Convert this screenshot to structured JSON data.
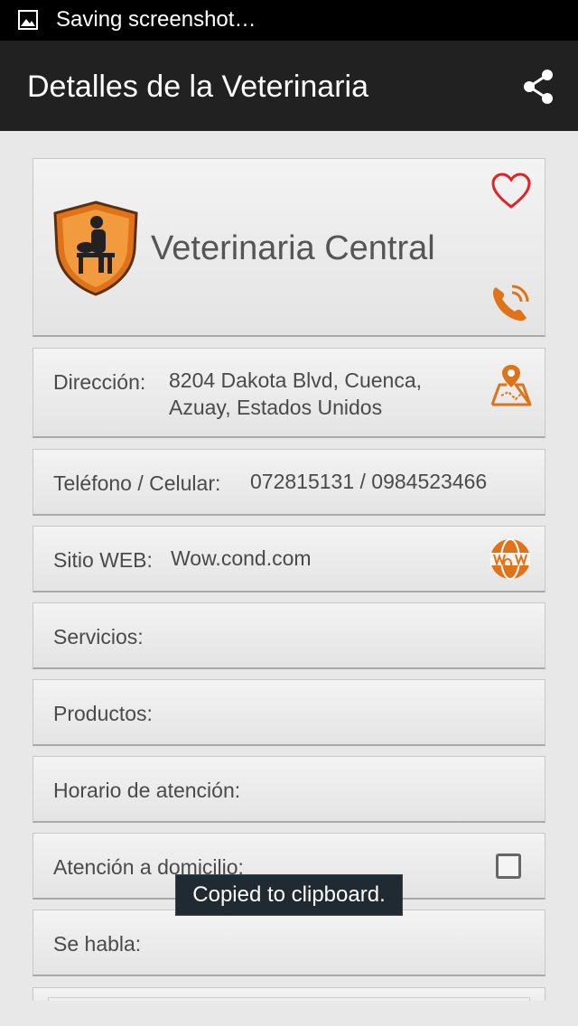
{
  "status_bar": {
    "notification_text": "Saving screenshot…",
    "icon": "image-icon"
  },
  "action_bar": {
    "title": "Detalles de la Veterinaria",
    "share_icon": "share-icon"
  },
  "header_card": {
    "name": "Veterinaria Central",
    "logo": "vet-shield-logo",
    "favorite_icon": "heart-icon",
    "call_icon": "phone-icon"
  },
  "direccion": {
    "label": "Dirección:",
    "line1": "8204  Dakota Blvd, Cuenca,",
    "line2": "Azuay, Estados Unidos",
    "icon": "map-pin-icon"
  },
  "telefono": {
    "label": "Teléfono / Celular:",
    "value": "072815131 / 0984523466"
  },
  "sitio_web": {
    "label": "Sitio WEB:",
    "value": "Wow.cond.com",
    "icon": "www-globe-icon"
  },
  "servicios": {
    "label": "Servicios:"
  },
  "productos": {
    "label": "Productos:"
  },
  "horario": {
    "label": "Horario de atención:"
  },
  "atencion_domicilio": {
    "label": "Atención a domicilio:",
    "checked": false
  },
  "se_habla": {
    "label": "Se habla:"
  },
  "toast": {
    "text": "Copied to clipboard."
  },
  "colors": {
    "accent_orange": "#e0731a",
    "heart_red": "#e02424",
    "actionbar": "#212121"
  }
}
